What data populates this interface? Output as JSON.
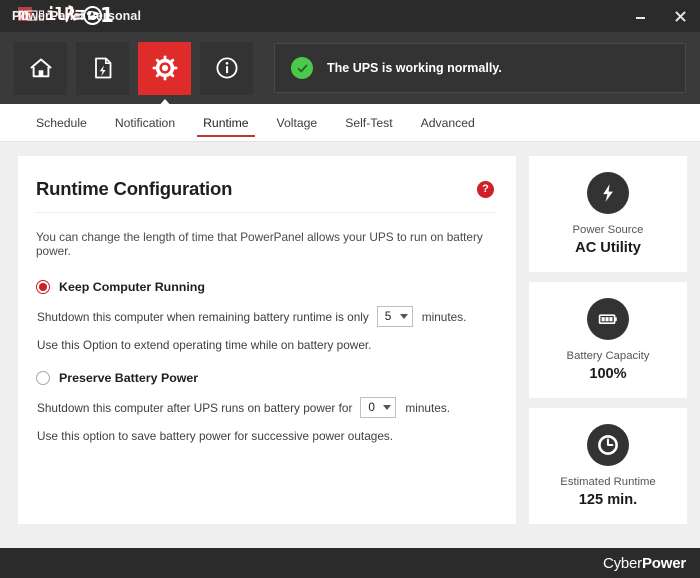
{
  "window": {
    "title": "PowerPanel Personal",
    "title_visible_suffix": "rsonal",
    "minimize_label": "Minimize",
    "close_label": "Close",
    "watermark": {
      "text": "mobile01",
      "prefix": "m",
      "mid": "bile",
      "suffix": "1"
    }
  },
  "toolbar": {
    "buttons": [
      {
        "name": "home",
        "label": "Home",
        "icon": "home-icon",
        "active": false
      },
      {
        "name": "power-report",
        "label": "Power Report",
        "icon": "document-lightning-icon",
        "active": false
      },
      {
        "name": "configuration",
        "label": "Configuration",
        "icon": "gear-icon",
        "active": true
      },
      {
        "name": "information",
        "label": "Information",
        "icon": "info-icon",
        "active": false
      }
    ],
    "status": {
      "icon": "check-circle-icon",
      "message": "The UPS is working normally.",
      "color": "#4cc94c"
    }
  },
  "tabs": [
    {
      "label": "Schedule",
      "active": false
    },
    {
      "label": "Notification",
      "active": false
    },
    {
      "label": "Runtime",
      "active": true
    },
    {
      "label": "Voltage",
      "active": false
    },
    {
      "label": "Self-Test",
      "active": false
    },
    {
      "label": "Advanced",
      "active": false
    }
  ],
  "main": {
    "title": "Runtime Configuration",
    "help_glyph": "?",
    "description": "You can change the length of time that PowerPanel allows your UPS to run on battery power.",
    "options": [
      {
        "label": "Keep Computer Running",
        "selected": true,
        "line_pre": "Shutdown this computer when remaining battery runtime is only",
        "value": "5",
        "line_post": "minutes.",
        "note": "Use this Option to extend operating time while on battery power."
      },
      {
        "label": "Preserve Battery Power",
        "selected": false,
        "line_pre": "Shutdown this computer after UPS runs on battery power for",
        "value": "0",
        "line_post": "minutes.",
        "note": "Use this option to save battery power for successive power outages."
      }
    ]
  },
  "sidebar": {
    "cards": [
      {
        "icon": "lightning-bolt-icon",
        "label": "Power Source",
        "value": "AC Utility"
      },
      {
        "icon": "battery-icon",
        "label": "Battery Capacity",
        "value": "100%"
      },
      {
        "icon": "clock-icon",
        "label": "Estimated Runtime",
        "value": "125 min."
      }
    ]
  },
  "footer": {
    "brand_first": "Cyber",
    "brand_second": "Power"
  },
  "colors": {
    "accent_red": "#e02b2b",
    "tab_underline": "#c0392b",
    "status_green": "#4cc94c",
    "chrome_dark": "#2b2b2b",
    "toolbar_dark": "#3a3a3a",
    "page_bg": "#efefef"
  }
}
